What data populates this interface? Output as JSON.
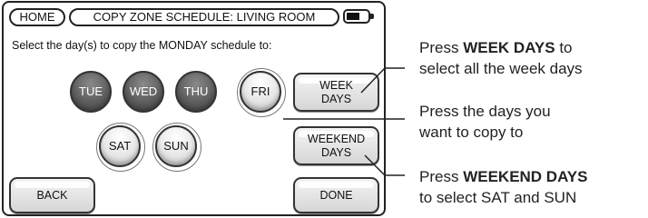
{
  "header": {
    "home_label": "HOME",
    "title": "COPY ZONE SCHEDULE: LIVING ROOM"
  },
  "instruction": "Select the day(s) to copy the MONDAY schedule to:",
  "days": [
    {
      "label": "TUE",
      "selected": true
    },
    {
      "label": "WED",
      "selected": true
    },
    {
      "label": "THU",
      "selected": true
    },
    {
      "label": "FRI",
      "selected": false
    },
    {
      "label": "SAT",
      "selected": false
    },
    {
      "label": "SUN",
      "selected": false
    }
  ],
  "buttons": {
    "week_days": {
      "line1": "WEEK",
      "line2": "DAYS"
    },
    "weekend_days": {
      "line1": "WEEKEND",
      "line2": "DAYS"
    },
    "back": "BACK",
    "done": "DONE"
  },
  "callouts": {
    "week_days": {
      "prefix": "Press ",
      "bold": "WEEK DAYS",
      "suffix": " to",
      "line2": "select all the week days"
    },
    "days": {
      "line1": "Press the days you",
      "line2": "want to copy to"
    },
    "weekend_days": {
      "prefix": "Press ",
      "bold": "WEEKEND DAYS",
      "line2": "to select SAT and SUN"
    }
  },
  "colors": {
    "selected_day": "#5e5e5e",
    "unselected_day": "#e6e6e6",
    "border": "#222222"
  }
}
